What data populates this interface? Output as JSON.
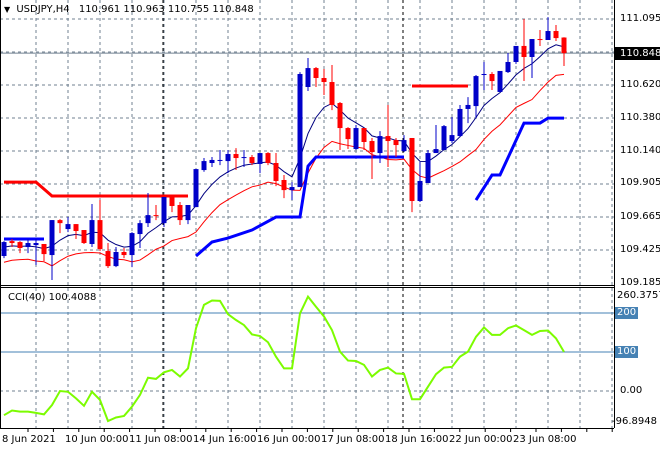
{
  "header": {
    "symbol_label": "USDJPY,H4",
    "ohlc": "110.961 110.963 110.755 110.848"
  },
  "price_axis": {
    "labels": [
      "111.095",
      "110.620",
      "110.380",
      "110.140",
      "109.905",
      "109.665",
      "109.425",
      "109.185"
    ],
    "bid": "110.848"
  },
  "cci_panel": {
    "label": "CCI(40) 100.4088",
    "max": "260.3757",
    "level_200": "200",
    "level_100": "100",
    "zero": "0.00",
    "min": "-96.8948"
  },
  "time_axis": [
    "8 Jun 2021",
    "10 Jun 00:00",
    "11 Jun 08:00",
    "14 Jun 16:00",
    "16 Jun 00:00",
    "17 Jun 08:00",
    "18 Jun 16:00",
    "22 Jun 00:00",
    "23 Jun 08:00"
  ],
  "colors": {
    "bull": "#0000c8",
    "bear": "#ff0000",
    "ma_fast": "#000080",
    "ma_slow": "#ff0000",
    "resistance": "#ff0000",
    "support": "#0000ff",
    "cci": "#7cfc00",
    "level": "#4682b4",
    "grid": "#708090"
  },
  "chart_data": [
    {
      "type": "candlestick",
      "title": "USDJPY,H4",
      "ylim": [
        109.185,
        111.095
      ],
      "ohlc": [
        [
          109.38,
          109.488,
          109.365,
          109.481
        ],
        [
          109.488,
          109.503,
          109.445,
          109.474
        ],
        [
          109.481,
          109.488,
          109.401,
          109.438
        ],
        [
          109.445,
          109.503,
          109.401,
          109.474
        ],
        [
          109.459,
          109.503,
          109.315,
          109.474
        ],
        [
          109.467,
          109.467,
          109.344,
          109.394
        ],
        [
          109.387,
          109.64,
          109.206,
          109.64
        ],
        [
          109.64,
          109.647,
          109.546,
          109.618
        ],
        [
          109.575,
          109.662,
          109.553,
          109.611
        ],
        [
          109.611,
          109.611,
          109.503,
          109.561
        ],
        [
          109.568,
          109.568,
          109.467,
          109.474
        ],
        [
          109.467,
          109.756,
          109.445,
          109.64
        ],
        [
          109.64,
          109.785,
          109.416,
          109.43
        ],
        [
          109.416,
          109.474,
          109.293,
          109.307
        ],
        [
          109.307,
          109.445,
          109.3,
          109.409
        ],
        [
          109.409,
          109.438,
          109.365,
          109.387
        ],
        [
          109.387,
          109.553,
          109.3,
          109.546
        ],
        [
          109.539,
          109.64,
          109.438,
          109.618
        ],
        [
          109.618,
          109.836,
          109.59,
          109.676
        ],
        [
          109.676,
          109.749,
          109.64,
          109.669
        ],
        [
          109.618,
          109.807,
          109.59,
          109.807
        ],
        [
          109.807,
          109.814,
          109.698,
          109.742
        ],
        [
          109.749,
          109.771,
          109.604,
          109.64
        ],
        [
          109.64,
          109.749,
          109.611,
          109.749
        ],
        [
          109.734,
          110.009,
          109.734,
          110.009
        ],
        [
          110.002,
          110.089,
          109.99,
          110.067
        ],
        [
          110.053,
          110.096,
          110.024,
          110.075
        ],
        [
          110.07,
          110.147,
          110.038,
          110.075
        ],
        [
          110.067,
          110.147,
          109.98,
          110.118
        ],
        [
          110.118,
          110.161,
          110.002,
          110.089
        ],
        [
          110.092,
          110.147,
          110.024,
          110.096
        ],
        [
          110.096,
          110.111,
          110.038,
          110.053
        ],
        [
          110.046,
          110.125,
          109.98,
          110.125
        ],
        [
          110.125,
          110.132,
          110.038,
          110.053
        ],
        [
          110.053,
          110.125,
          109.886,
          109.923
        ],
        [
          109.93,
          109.966,
          109.799,
          109.857
        ],
        [
          109.857,
          109.915,
          109.785,
          109.879
        ],
        [
          109.879,
          110.711,
          109.879,
          110.697
        ],
        [
          110.603,
          110.813,
          110.574,
          110.74
        ],
        [
          110.74,
          110.748,
          110.603,
          110.668
        ],
        [
          110.668,
          110.733,
          110.545,
          110.639
        ],
        [
          110.639,
          110.762,
          110.436,
          110.473
        ],
        [
          110.487,
          110.494,
          110.147,
          110.306
        ],
        [
          110.306,
          110.313,
          110.154,
          110.226
        ],
        [
          110.154,
          110.328,
          110.147,
          110.306
        ],
        [
          110.306,
          110.306,
          110.147,
          110.205
        ],
        [
          110.212,
          110.234,
          109.937,
          110.132
        ],
        [
          110.125,
          110.284,
          110.053,
          110.248
        ],
        [
          110.248,
          110.473,
          110.024,
          110.212
        ],
        [
          110.219,
          110.234,
          110.096,
          110.183
        ],
        [
          110.139,
          110.255,
          110.132,
          110.219
        ],
        [
          110.234,
          110.234,
          109.698,
          109.778
        ],
        [
          109.778,
          110.06,
          109.771,
          109.923
        ],
        [
          109.908,
          110.147,
          109.908,
          110.125
        ],
        [
          110.125,
          110.328,
          110.125,
          110.154
        ],
        [
          110.147,
          110.328,
          110.147,
          110.32
        ],
        [
          110.212,
          110.386,
          110.197,
          110.255
        ],
        [
          110.248,
          110.473,
          110.24,
          110.444
        ],
        [
          110.444,
          110.53,
          110.342,
          110.473
        ],
        [
          110.465,
          110.69,
          110.378,
          110.682
        ],
        [
          110.69,
          110.784,
          110.581,
          110.697
        ],
        [
          110.697,
          110.711,
          110.581,
          110.646
        ],
        [
          110.567,
          110.719,
          110.567,
          110.719
        ],
        [
          110.711,
          110.849,
          110.704,
          110.784
        ],
        [
          110.784,
          110.9,
          110.77,
          110.9
        ],
        [
          110.9,
          111.095,
          110.646,
          110.82
        ],
        [
          110.82,
          110.95,
          110.668,
          110.95
        ],
        [
          110.95,
          111.015,
          110.9,
          110.943
        ],
        [
          110.943,
          111.109,
          110.943,
          111.008
        ],
        [
          111.008,
          111.052,
          110.936,
          110.957
        ],
        [
          110.961,
          110.963,
          110.755,
          110.848
        ]
      ],
      "resistance_segments": [
        [
          [
            0,
            109.915
          ],
          [
            4,
            109.915
          ],
          [
            6,
            109.814
          ],
          [
            23,
            109.814
          ]
        ],
        [
          [
            51,
            110.61
          ],
          [
            58,
            110.61
          ]
        ]
      ],
      "support_segments": [
        [
          [
            0,
            109.503
          ],
          [
            5,
            109.503
          ]
        ],
        [
          [
            24,
            109.38
          ],
          [
            26,
            109.481
          ],
          [
            28,
            109.51
          ],
          [
            31,
            109.568
          ],
          [
            34,
            109.662
          ],
          [
            37,
            109.662
          ],
          [
            38,
            110.03
          ],
          [
            39,
            110.096
          ],
          [
            50,
            110.096
          ]
        ],
        [
          [
            59,
            109.785
          ],
          [
            61,
            109.966
          ],
          [
            62,
            109.966
          ],
          [
            65,
            110.342
          ],
          [
            67,
            110.342
          ],
          [
            68,
            110.378
          ],
          [
            70,
            110.378
          ]
        ]
      ],
      "bid": 110.848
    },
    {
      "type": "line",
      "title": "CCI(40) 100.4088",
      "ylim": [
        -96.8948,
        260.3757
      ],
      "levels": [
        200,
        100,
        0
      ],
      "values": [
        -62,
        -50,
        -53,
        -53,
        -56,
        -60,
        -36,
        0,
        -2,
        -19,
        -38,
        -2,
        -23,
        -77,
        -68,
        -64,
        -40,
        -10,
        34,
        31,
        48,
        54,
        37,
        58,
        161,
        221,
        232,
        231,
        197,
        182,
        169,
        145,
        141,
        125,
        88,
        58,
        58,
        199,
        242,
        216,
        191,
        156,
        101,
        78,
        77,
        67,
        37,
        54,
        60,
        45,
        44,
        -21,
        -21,
        11,
        43,
        60,
        62,
        88,
        101,
        139,
        163,
        144,
        144,
        161,
        168,
        156,
        144,
        154,
        155,
        135,
        100.4088
      ]
    }
  ]
}
